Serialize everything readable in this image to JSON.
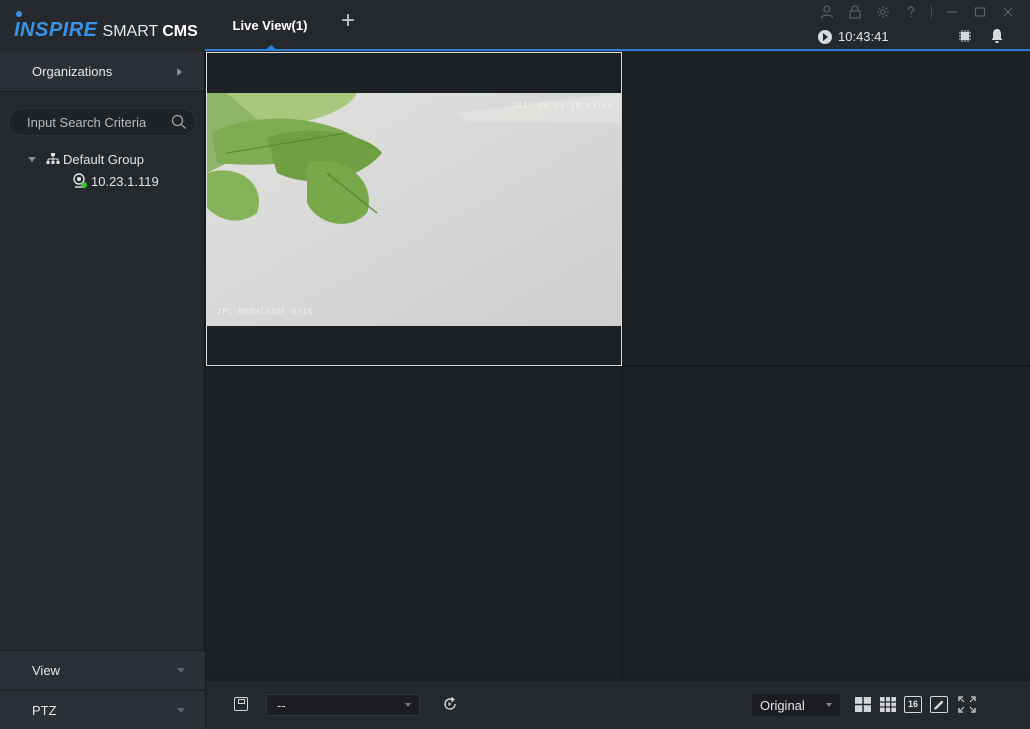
{
  "app": {
    "logo_brand": "INSPIRE",
    "logo_smart": "SMART",
    "logo_cms": "CMS",
    "active_tab": "Live View(1)",
    "add_tab_symbol": "+",
    "clock": "10:43:41",
    "accent_color": "#2f7fd6"
  },
  "sidebar": {
    "header": "Organizations",
    "search_placeholder": "Input Search Criteria",
    "tree": {
      "group_label": "Default Group",
      "device_label": "10.23.1.119",
      "device_status_color": "#3bc43b"
    },
    "bottom_sections": [
      "View",
      "PTZ"
    ]
  },
  "video": {
    "osd_top": "2017-06-21 10:43:46",
    "osd_bottom": "IPC-HDBW1320E-0315"
  },
  "toolbar": {
    "view_select_value": "--",
    "ratio_value": "Original",
    "layout_16_label": "16"
  }
}
